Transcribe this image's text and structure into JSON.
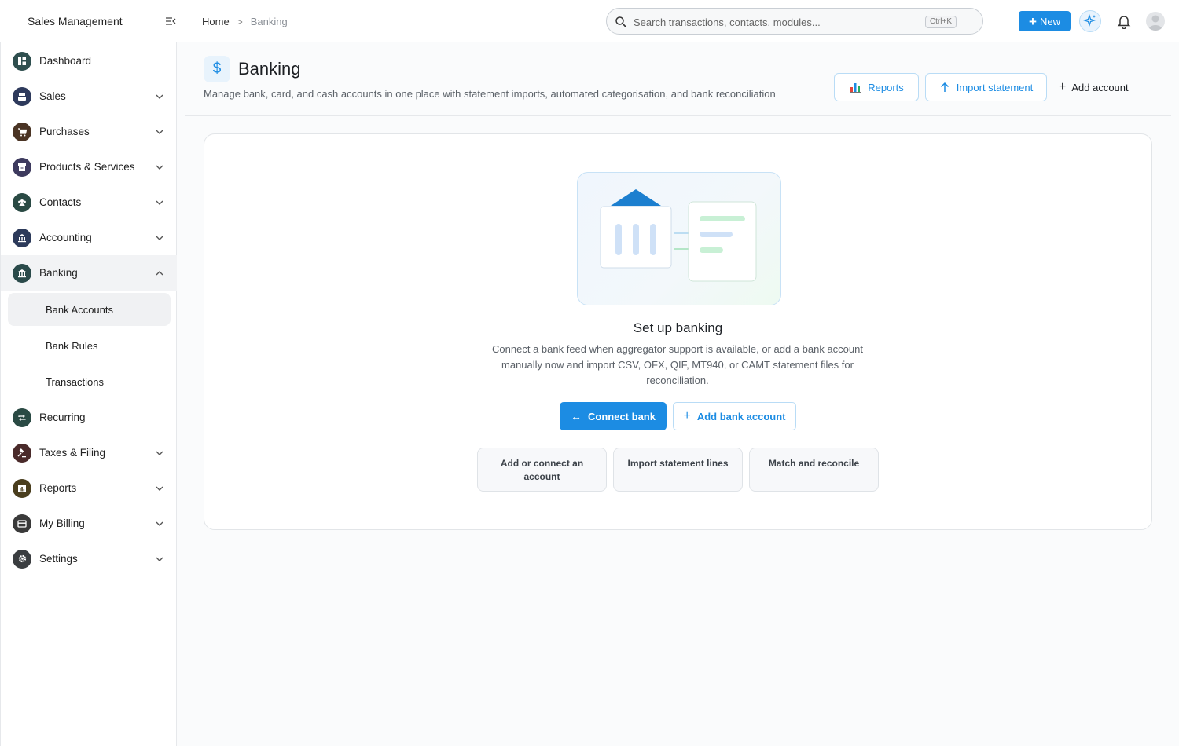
{
  "app": {
    "title": "Sales Management"
  },
  "breadcrumb": {
    "home": "Home",
    "separator": ">",
    "current": "Banking"
  },
  "search": {
    "placeholder": "Search transactions, contacts, modules...",
    "shortcut": "Ctrl+K"
  },
  "topbar": {
    "new_label": "New"
  },
  "sidebar": {
    "items": [
      {
        "label": "Dashboard",
        "icon": "dashboard-icon",
        "color": "#2f4f4f"
      },
      {
        "label": "Sales",
        "icon": "register-icon",
        "color": "#2e3a5c"
      },
      {
        "label": "Purchases",
        "icon": "cart-icon",
        "color": "#4a3424"
      },
      {
        "label": "Products & Services",
        "icon": "box-icon",
        "color": "#3d3a5e"
      },
      {
        "label": "Contacts",
        "icon": "people-icon",
        "color": "#2a4a44"
      },
      {
        "label": "Accounting",
        "icon": "bank-icon",
        "color": "#2c3a5a"
      },
      {
        "label": "Banking",
        "icon": "bank-icon",
        "color": "#2a4a4a"
      },
      {
        "label": "Recurring",
        "icon": "repeat-icon",
        "color": "#2a4a44"
      },
      {
        "label": "Taxes & Filing",
        "icon": "gavel-icon",
        "color": "#4a2a2a"
      },
      {
        "label": "Reports",
        "icon": "report-icon",
        "color": "#4a3e1e"
      },
      {
        "label": "My Billing",
        "icon": "card-icon",
        "color": "#3a3a3a"
      },
      {
        "label": "Settings",
        "icon": "gear-icon",
        "color": "#3a3d40"
      }
    ],
    "banking_sub": [
      {
        "label": "Bank Accounts"
      },
      {
        "label": "Bank Rules"
      },
      {
        "label": "Transactions"
      }
    ]
  },
  "page": {
    "title": "Banking",
    "icon_glyph": "$",
    "subtitle": "Manage bank, card, and cash accounts in one place with statement imports, automated categorisation, and bank reconciliation",
    "reports_label": "Reports",
    "import_label": "Import statement",
    "add_account_label": "Add account"
  },
  "empty_state": {
    "title": "Set up banking",
    "description": "Connect a bank feed when aggregator support is available, or add a bank account manually now and import CSV, OFX, QIF, MT940, or CAMT statement files for reconciliation.",
    "connect_label": "Connect bank",
    "add_bank_label": "Add bank account",
    "steps": [
      {
        "label": "Add or connect an account"
      },
      {
        "label": "Import statement lines"
      },
      {
        "label": "Match and reconcile"
      }
    ]
  },
  "colors": {
    "accent": "#1c8ce3",
    "border": "#e2e5e8"
  }
}
